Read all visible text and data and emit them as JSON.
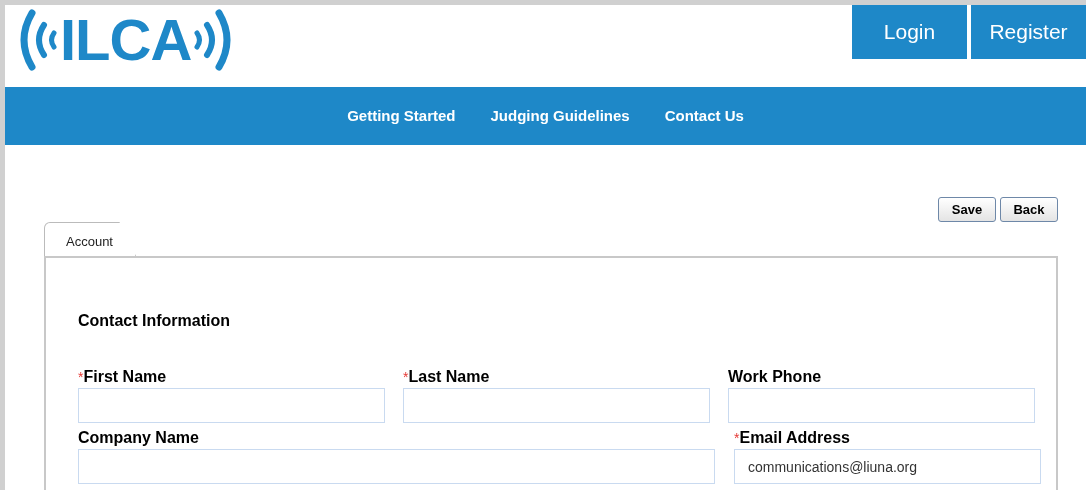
{
  "logo": {
    "text": "ILCA"
  },
  "header_buttons": [
    "Login",
    "Register"
  ],
  "nav": [
    "Getting Started",
    "Judging Guidelines",
    "Contact Us"
  ],
  "actions": [
    "Save",
    "Back"
  ],
  "tabs": [
    {
      "label": "Account",
      "selected": true
    }
  ],
  "section_title": "Contact Information",
  "rows": [
    [
      {
        "label": "First Name",
        "required_mark": "*"
      },
      {
        "label": "Last Name",
        "required_mark": "*"
      },
      {
        "label": "Work Phone"
      }
    ],
    [
      {
        "label": "Company Name"
      },
      {
        "label": "Email Address",
        "required_mark": "*",
        "value": "communications@liuna.org"
      }
    ]
  ]
}
